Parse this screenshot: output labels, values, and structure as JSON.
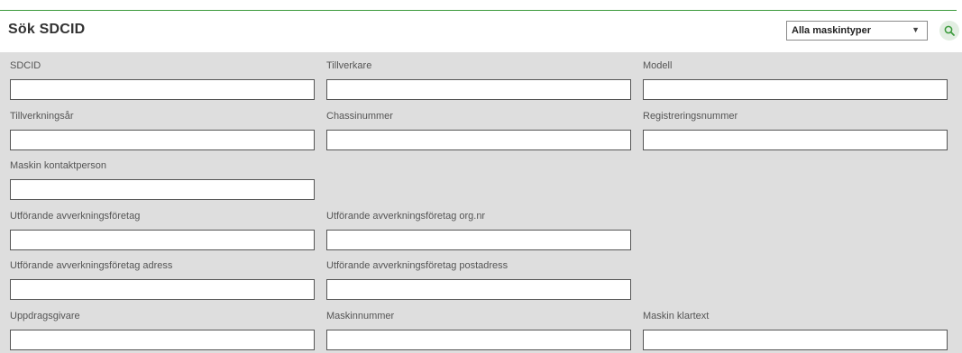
{
  "header": {
    "title": "Sök SDCID",
    "machine_type_select": {
      "selected": "Alla maskintyper",
      "arrow_icon": "triangle-down"
    },
    "search_button_icon": "search-icon"
  },
  "colors": {
    "accent_green": "#3a9a3a",
    "panel_background": "#dedede"
  },
  "form": {
    "fields": [
      {
        "label": "SDCID",
        "value": ""
      },
      {
        "label": "Tillverkare",
        "value": ""
      },
      {
        "label": "Modell",
        "value": ""
      },
      {
        "label": "Tillverkningsår",
        "value": ""
      },
      {
        "label": "Chassinummer",
        "value": ""
      },
      {
        "label": "Registreringsnummer",
        "value": ""
      },
      {
        "label": "Maskin kontaktperson",
        "value": ""
      },
      {
        "label": "Utförande avverkningsföretag",
        "value": ""
      },
      {
        "label": "Utförande avverkningsföretag org.nr",
        "value": ""
      },
      {
        "label": "Utförande avverkningsföretag adress",
        "value": ""
      },
      {
        "label": "Utförande avverkningsföretag postadress",
        "value": ""
      },
      {
        "label": "Uppdragsgivare",
        "value": ""
      },
      {
        "label": "Maskinnummer",
        "value": ""
      },
      {
        "label": "Maskin klartext",
        "value": ""
      }
    ]
  }
}
